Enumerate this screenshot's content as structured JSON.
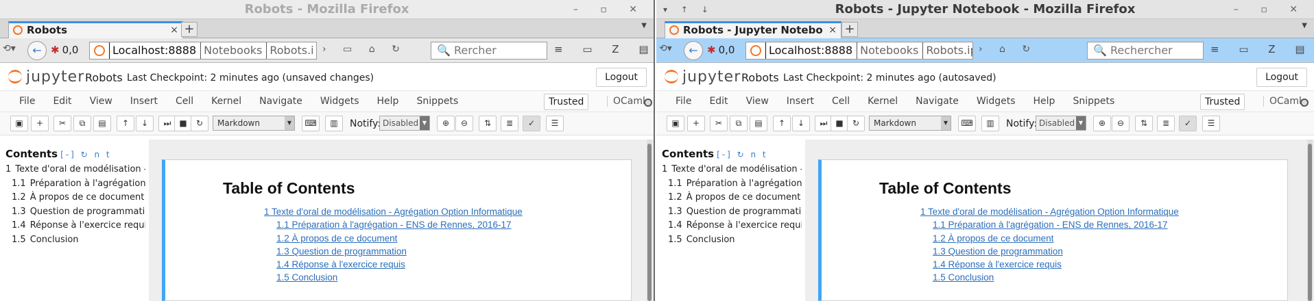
{
  "windows": [
    {
      "title": "Robots - Mozilla Firefox",
      "tab_label": "Robots",
      "url": {
        "host": "Localhost:8888",
        "crumbs": [
          "Notebooks",
          "Robots.i"
        ],
        "overflow": ">"
      },
      "search_placeholder": "Rercher",
      "addon_counter": "0,0",
      "notebook": {
        "name": "Robots",
        "checkpoint": "Last Checkpoint: 2 minutes ago (unsaved changes)"
      }
    },
    {
      "title": "Robots - Jupyter Notebook - Mozilla Firefox",
      "tab_label": "Robots - Jupyter Notebo",
      "url": {
        "host": "Localhost:8888",
        "crumbs": [
          "Notebooks",
          "Robots.ipyn"
        ],
        "overflow": ">"
      },
      "search_placeholder": "Rechercher",
      "addon_counter": "0,0",
      "notebook": {
        "name": "Robots",
        "checkpoint": "Last Checkpoint: 2 minutes ago (autosaved)"
      }
    }
  ],
  "jupyter": {
    "logo_text": "jupyter",
    "logout_label": "Logout",
    "menu": [
      "File",
      "Edit",
      "View",
      "Insert",
      "Cell",
      "Kernel",
      "Navigate",
      "Widgets",
      "Help",
      "Snippets"
    ],
    "trusted_label": "Trusted",
    "kernel_name": "OCaml",
    "cell_type": "Markdown",
    "notify_label": "Notify:",
    "notify_value": "Disabled"
  },
  "toc_sidebar": {
    "title": "Contents",
    "controls": "[-] ↻ n t",
    "items": [
      {
        "num": "1",
        "label": "Texte d'oral de modélisation - Ag"
      },
      {
        "num": "1.1",
        "label": "Préparation à l'agrégation - E"
      },
      {
        "num": "1.2",
        "label": "À propos de ce document"
      },
      {
        "num": "1.3",
        "label": "Question de programmation"
      },
      {
        "num": "1.4",
        "label": "Réponse à l'exercice requis"
      },
      {
        "num": "1.5",
        "label": "Conclusion"
      }
    ]
  },
  "toc_cell": {
    "heading": "Table of Contents",
    "links": [
      "1  Texte d'oral de modélisation - Agrégation Option Informatique",
      "1.1  Préparation à l'agrégation - ENS de Rennes, 2016-17",
      "1.2  À propos de ce document",
      "1.3  Question de programmation",
      "1.4  Réponse à l'exercice requis",
      "1.5  Conclusion"
    ]
  },
  "colors": {
    "firefox_tab_accent": "#3c8ee0",
    "active_navbar": "#a8d3f8",
    "jupyter_orange": "#f37726",
    "cell_left_border": "#42a5f5",
    "link": "#2a6ebb"
  }
}
